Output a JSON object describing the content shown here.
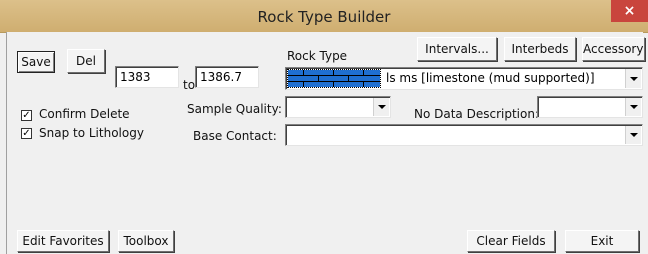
{
  "window": {
    "title": "Rock Type Builder",
    "close_glyph": "×"
  },
  "buttons": {
    "save": "Save",
    "del": "Del",
    "intervals": "Intervals...",
    "interbeds": "Interbeds",
    "accessory": "Accessory",
    "edit_favorites": "Edit Favorites",
    "toolbox": "Toolbox",
    "clear_fields": "Clear Fields",
    "exit": "Exit"
  },
  "depth": {
    "from": "1383",
    "to_label": "to",
    "to": "1386.7"
  },
  "rock_type": {
    "label": "Rock Type",
    "value": "ls ms [limestone (mud supported)]",
    "swatch_color": "#1f6fd1"
  },
  "checkboxes": [
    {
      "label": "Confirm Delete",
      "checked": true
    },
    {
      "label": "Snap to Lithology",
      "checked": true
    }
  ],
  "sample_quality": {
    "label": "Sample Quality:",
    "value": ""
  },
  "no_data_description": {
    "label": "No Data Description:",
    "value": ""
  },
  "base_contact": {
    "label": "Base Contact:",
    "value": ""
  },
  "colors": {
    "titlebar": "#d4b57a",
    "close_button": "#c9453d",
    "window_bg": "#f0f0f0"
  }
}
